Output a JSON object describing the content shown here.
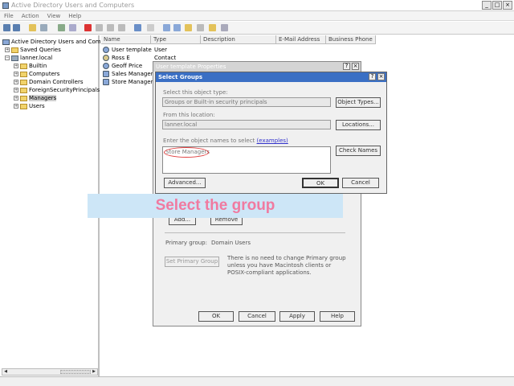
{
  "window": {
    "title": "Active Directory Users and Computers",
    "buttons": [
      "_",
      "□",
      "×"
    ]
  },
  "menu": [
    "File",
    "Action",
    "View",
    "Help"
  ],
  "tree": {
    "root": "Active Directory Users and Compu",
    "items": [
      {
        "label": "Saved Queries",
        "level": 1,
        "expander": "+"
      },
      {
        "label": "lanner.local",
        "level": 1,
        "expander": "−"
      },
      {
        "label": "Builtin",
        "level": 2,
        "expander": "+"
      },
      {
        "label": "Computers",
        "level": 2,
        "expander": "+"
      },
      {
        "label": "Domain Controllers",
        "level": 2,
        "expander": "+"
      },
      {
        "label": "ForeignSecurityPrincipals",
        "level": 2,
        "expander": "+"
      },
      {
        "label": "Managers",
        "level": 2,
        "expander": "+",
        "selected": true
      },
      {
        "label": "Users",
        "level": 2,
        "expander": "+"
      }
    ]
  },
  "list": {
    "columns": [
      "Name",
      "Type",
      "Description",
      "E-Mail Address",
      "Business Phone"
    ],
    "rows": [
      {
        "name": "User template",
        "type": "User"
      },
      {
        "name": "Ross E",
        "type": "Contact"
      },
      {
        "name": "Geoff Price",
        "type": ""
      },
      {
        "name": "Sales Managers",
        "type": ""
      },
      {
        "name": "Store Managers",
        "type": ""
      }
    ]
  },
  "props_dialog": {
    "title": "User template Properties",
    "help": "?",
    "close": "×",
    "add_button": "Add...",
    "remove_button": "Remove",
    "primary_group_label": "Primary group:",
    "primary_group_value": "Domain Users",
    "set_primary_button": "Set Primary Group",
    "info_text": "There is no need to change Primary group unless you have Macintosh clients or POSIX-compliant applications.",
    "ok": "OK",
    "cancel": "Cancel",
    "apply": "Apply",
    "help_btn": "Help"
  },
  "select_groups": {
    "title": "Select Groups",
    "help": "?",
    "close": "×",
    "object_type_label": "Select this object type:",
    "object_type_value": "Groups or Built-in security principals",
    "object_types_button": "Object Types...",
    "location_label": "From this location:",
    "location_value": "lanner.local",
    "locations_button": "Locations...",
    "names_label": "Enter the object names to select",
    "examples_link": "(examples)",
    "names_value": "Store Managers",
    "check_names_button": "Check Names",
    "advanced_button": "Advanced...",
    "ok": "OK",
    "cancel": "Cancel"
  },
  "banner": {
    "text": "Select the group"
  },
  "colors": {
    "banner_bg": "#cde6f7",
    "banner_text": "#f07aa0",
    "annotation": "#e04040"
  }
}
